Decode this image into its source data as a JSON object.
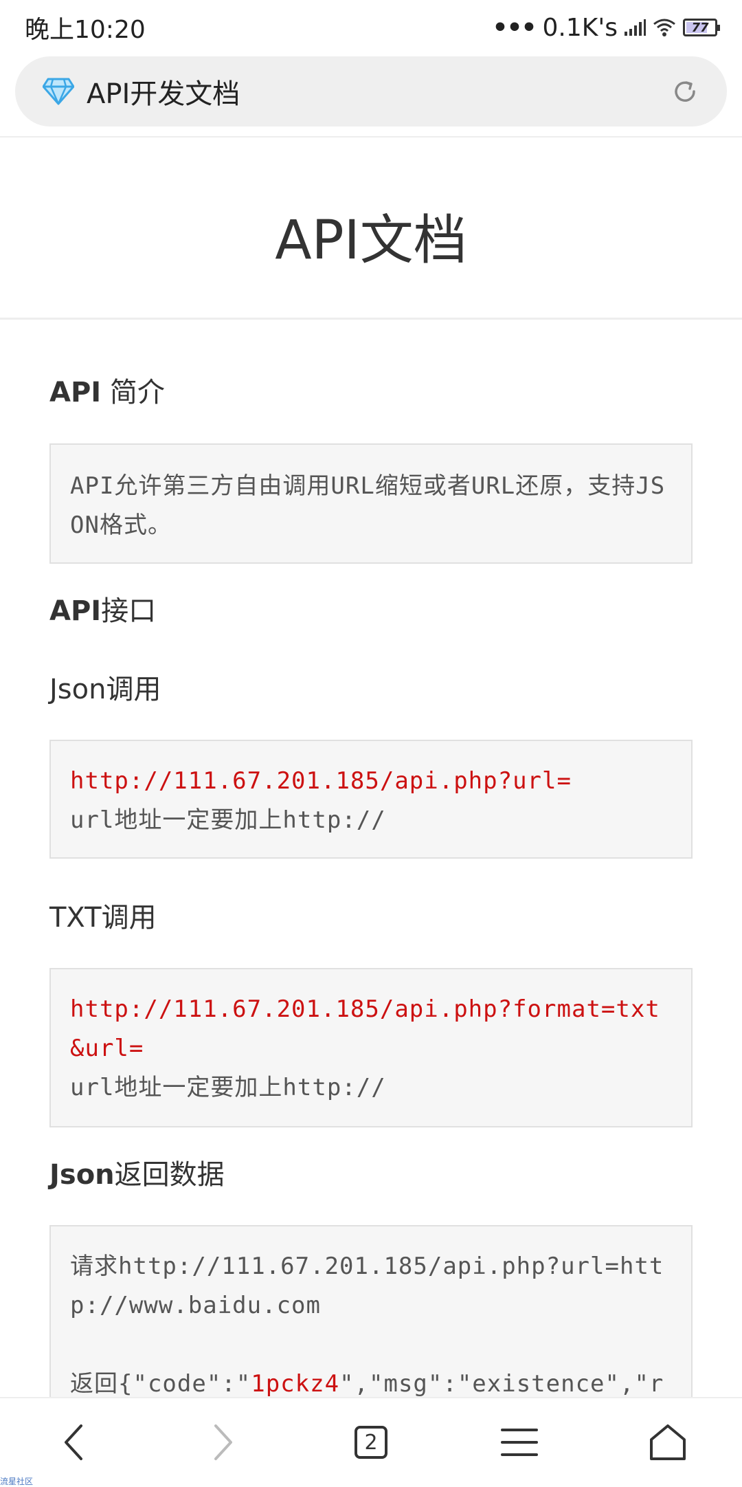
{
  "status_bar": {
    "time": "晚上10:20",
    "speed": "0.1K's",
    "battery": "77"
  },
  "address_bar": {
    "title": "API开发文档",
    "icon": "diamond-icon",
    "reload_icon": "reload-icon"
  },
  "page": {
    "title": "API文档",
    "intro": {
      "heading_bold": "API",
      "heading_rest": " 简介",
      "text": "API允许第三方自由调用URL缩短或者URL还原，支持JSON格式。"
    },
    "interface": {
      "heading_bold": "API",
      "heading_rest": "接口"
    },
    "json_call": {
      "heading": "Json调用",
      "url": "http://111.67.201.185/api.php?url=",
      "note": "url地址一定要加上http://"
    },
    "txt_call": {
      "heading": "TXT调用",
      "url": "http://111.67.201.185/api.php?format=txt&url=",
      "note": "url地址一定要加上http://"
    },
    "json_return": {
      "heading_bold": "Json",
      "heading_rest": "返回数据",
      "request": "请求http://111.67.201.185/api.php?url=http://www.baidu.com",
      "response_prefix": "返回{\"code\":\"",
      "response_code": "1pckz4",
      "response_suffix": "\",\"msg\":\"existence\",\"r"
    }
  },
  "bottom_nav": {
    "tab_count": "2"
  },
  "watermark": "流星社区",
  "colors": {
    "link_red": "#cc1111",
    "box_bg": "#f6f6f6",
    "diamond": "#3ba7e6"
  }
}
